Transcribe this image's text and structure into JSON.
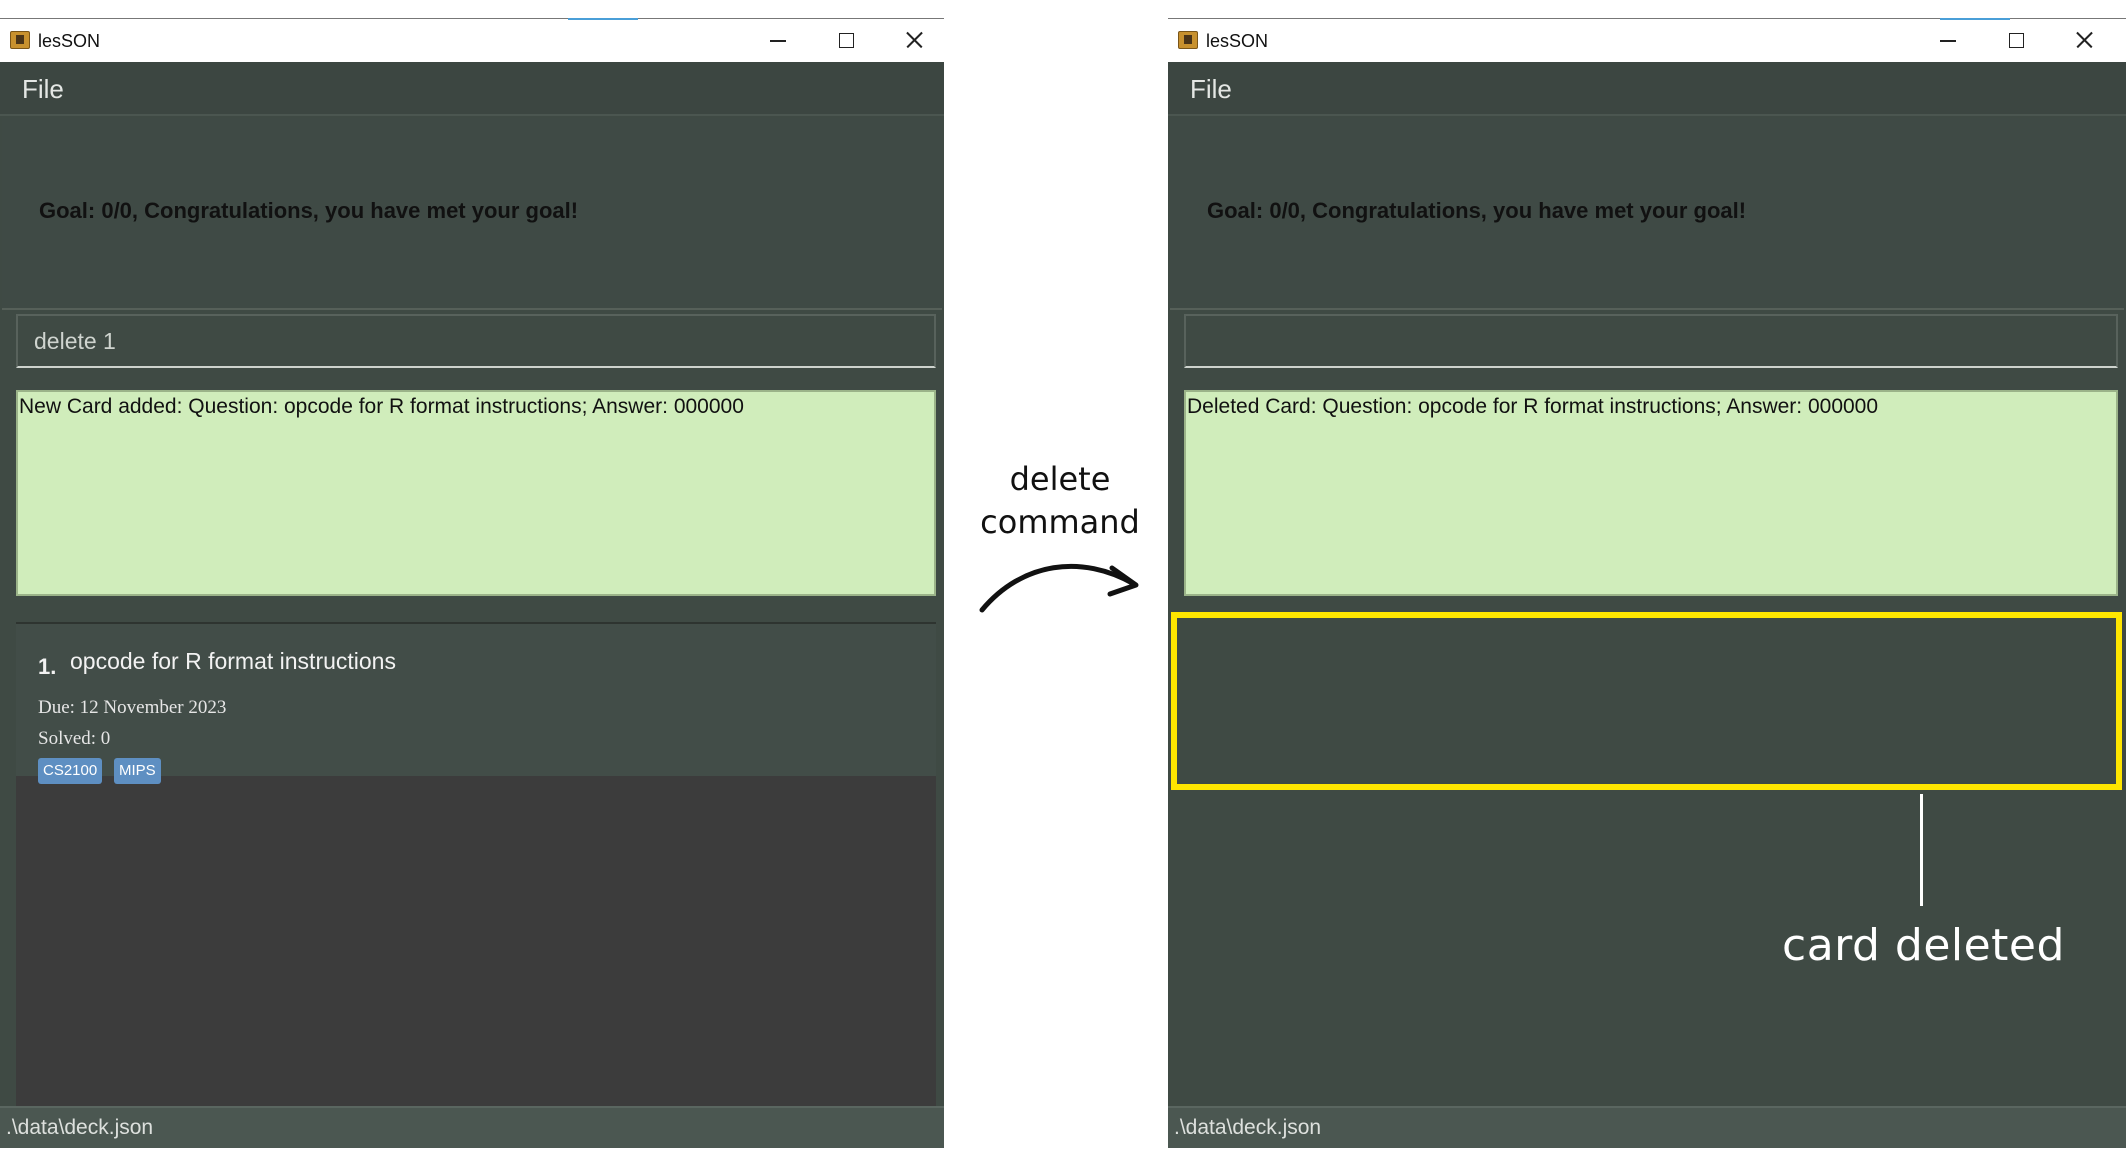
{
  "left_window": {
    "title": "lesSON",
    "menu": {
      "file_label": "File"
    },
    "goal_text": "Goal: 0/0, Congratulations, you have met your goal!",
    "command_input": {
      "value": "delete 1"
    },
    "result_text": "New Card added: Question: opcode for R format instructions; Answer: 000000",
    "cards": [
      {
        "index": "1.",
        "question": "opcode for R format instructions",
        "due": "Due: 12 November 2023",
        "solved": "Solved: 0",
        "tags": [
          "CS2100",
          "MIPS"
        ]
      }
    ],
    "status_path": ".\\data\\deck.json"
  },
  "right_window": {
    "title": "lesSON",
    "menu": {
      "file_label": "File"
    },
    "goal_text": "Goal: 0/0, Congratulations, you have met your goal!",
    "command_input": {
      "value": ""
    },
    "result_text": "Deleted Card: Question: opcode for R format instructions; Answer: 000000",
    "status_path": ".\\data\\deck.json"
  },
  "annotations": {
    "command_label_line1": "delete",
    "command_label_line2": "command",
    "callout": "card deleted",
    "highlight_color": "#ffe600"
  },
  "colors": {
    "window_bg": "#3f4a44",
    "result_bg": "#d0edbb",
    "tag_bg": "#5e8fc2",
    "list_bg": "#3c3c3c"
  }
}
